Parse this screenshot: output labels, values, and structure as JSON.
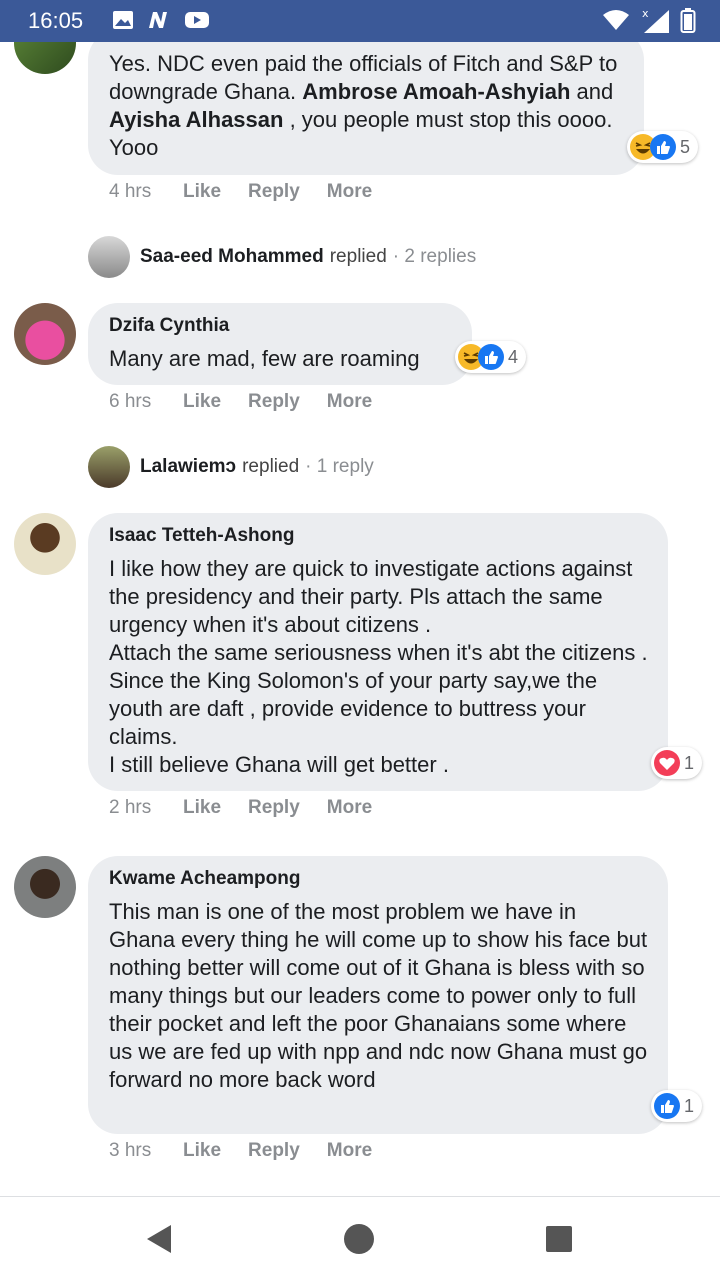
{
  "status_bar": {
    "time": "16:05",
    "icons": [
      "image-icon",
      "n-app-icon",
      "youtube-icon",
      "wifi-icon",
      "signal-icon",
      "battery-icon"
    ]
  },
  "comments": [
    {
      "text_parts": [
        "Yes. NDC even paid the officials of Fitch and S&P to downgrade Ghana. ",
        "Ambrose Amoah-Ashyiah",
        " and ",
        "Ayisha Alhassan",
        " , you people must stop this oooo. Yooo"
      ],
      "reactions": {
        "types": [
          "haha",
          "like"
        ],
        "count": "5"
      },
      "time": "4 hrs"
    },
    {
      "author": "Dzifa Cynthia",
      "text": "Many are mad, few are roaming",
      "reactions": {
        "types": [
          "haha",
          "like"
        ],
        "count": "4"
      },
      "time": "6 hrs",
      "replies": {
        "name": "Lalawiemɔ",
        "verb": "replied",
        "count": "· 1 reply"
      }
    },
    {
      "author": "Isaac Tetteh-Ashong",
      "text": "I like how they are quick to investigate actions against the presidency and their party. Pls attach the same urgency when it's about citizens .\nAttach the same seriousness when it's abt the citizens . Since the King Solomon's of your party say,we the youth are daft , provide evidence to buttress your claims.\nI still believe Ghana will get better .",
      "reactions": {
        "types": [
          "love"
        ],
        "count": "1"
      },
      "time": "2 hrs"
    },
    {
      "author": "Kwame Acheampong",
      "text": "This man is one of the most problem we have in Ghana every thing he will come up to show his face but nothing better will come out of it Ghana is bless with so many things but our leaders come to power only to full their pocket and left the poor Ghanaians some where us we are fed up with npp and ndc now Ghana must go forward no more back word",
      "reactions": {
        "types": [
          "like"
        ],
        "count": "1"
      },
      "time": "3 hrs"
    }
  ],
  "first_replies": {
    "name": "Saa-eed Mohammed",
    "verb": "replied",
    "count": "· 2 replies"
  },
  "actions": {
    "like": "Like",
    "reply": "Reply",
    "more": "More"
  },
  "nav": {
    "back": "back-icon",
    "home": "home-icon",
    "recents": "recents-icon"
  }
}
